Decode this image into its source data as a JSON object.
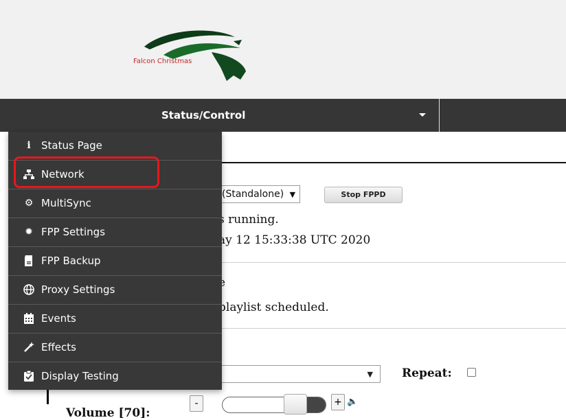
{
  "header": {
    "logo_text": "Falcon Christmas",
    "logo_colors": {
      "dark": "#0e3b18",
      "mid": "#1a6b2a",
      "text": "#c0282c"
    }
  },
  "navbar": {
    "status_control_label": "Status/Control",
    "caret_icon": "caret-down-icon"
  },
  "menu": {
    "items": [
      {
        "label": "Status Page",
        "icon": "info-icon"
      },
      {
        "label": "Network",
        "icon": "network-icon",
        "highlighted": true
      },
      {
        "label": "MultiSync",
        "icon": "cogs-icon"
      },
      {
        "label": "FPP Settings",
        "icon": "gear-icon"
      },
      {
        "label": "FPP Backup",
        "icon": "sd-card-icon"
      },
      {
        "label": "Proxy Settings",
        "icon": "globe-icon"
      },
      {
        "label": "Events",
        "icon": "calendar-icon"
      },
      {
        "label": "Effects",
        "icon": "magic-wand-icon"
      },
      {
        "label": "Display Testing",
        "icon": "clipboard-check-icon"
      }
    ],
    "highlight_color": "#e8171d"
  },
  "status": {
    "mode_value": "(Standalone)",
    "mode_caret": "▼",
    "stop_button_label": "Stop FPPD",
    "running_text": "s running.",
    "date_text": "ay 12 15:33:38 UTC 2020",
    "player_status_partial": "e",
    "playlist_text": "playlist scheduled."
  },
  "controls": {
    "playlist_caret": "▼",
    "repeat_label": "Repeat:",
    "volume_label": "Volume [70]:",
    "volume_value": 70,
    "vol_minus": "-",
    "vol_plus": "+"
  }
}
